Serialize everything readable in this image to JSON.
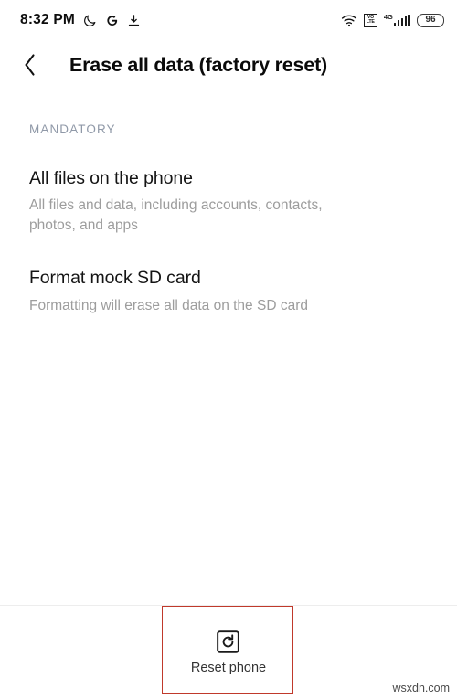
{
  "status_bar": {
    "clock": "8:32 PM",
    "left_icons": [
      {
        "name": "moon-icon",
        "label": "Do not disturb"
      },
      {
        "name": "google-icon",
        "label": "G"
      },
      {
        "name": "download-icon",
        "label": "Download"
      }
    ],
    "right_icons": [
      {
        "name": "wifi-icon",
        "label": "Wi-Fi"
      },
      {
        "name": "volte-icon",
        "label": "VoLTE",
        "line1": "VO",
        "line2": "LTE"
      },
      {
        "name": "signal-icon",
        "label": "4G",
        "network": "4G"
      }
    ],
    "battery": {
      "percent": "96"
    }
  },
  "app_bar": {
    "back_label": "Back",
    "title": "Erase all data (factory reset)"
  },
  "content": {
    "section_label": "MANDATORY",
    "items": [
      {
        "title": "All files on the phone",
        "description": "All files and data, including accounts, contacts, photos, and apps"
      },
      {
        "title": "Format mock SD card",
        "description": "Formatting will erase all data on the SD card"
      }
    ]
  },
  "bottom_bar": {
    "reset": {
      "icon": "reset-phone-icon",
      "label": "Reset phone"
    }
  },
  "annotation": {
    "color": "#c0392b"
  },
  "watermark": {
    "text": "wsxdn.com"
  }
}
